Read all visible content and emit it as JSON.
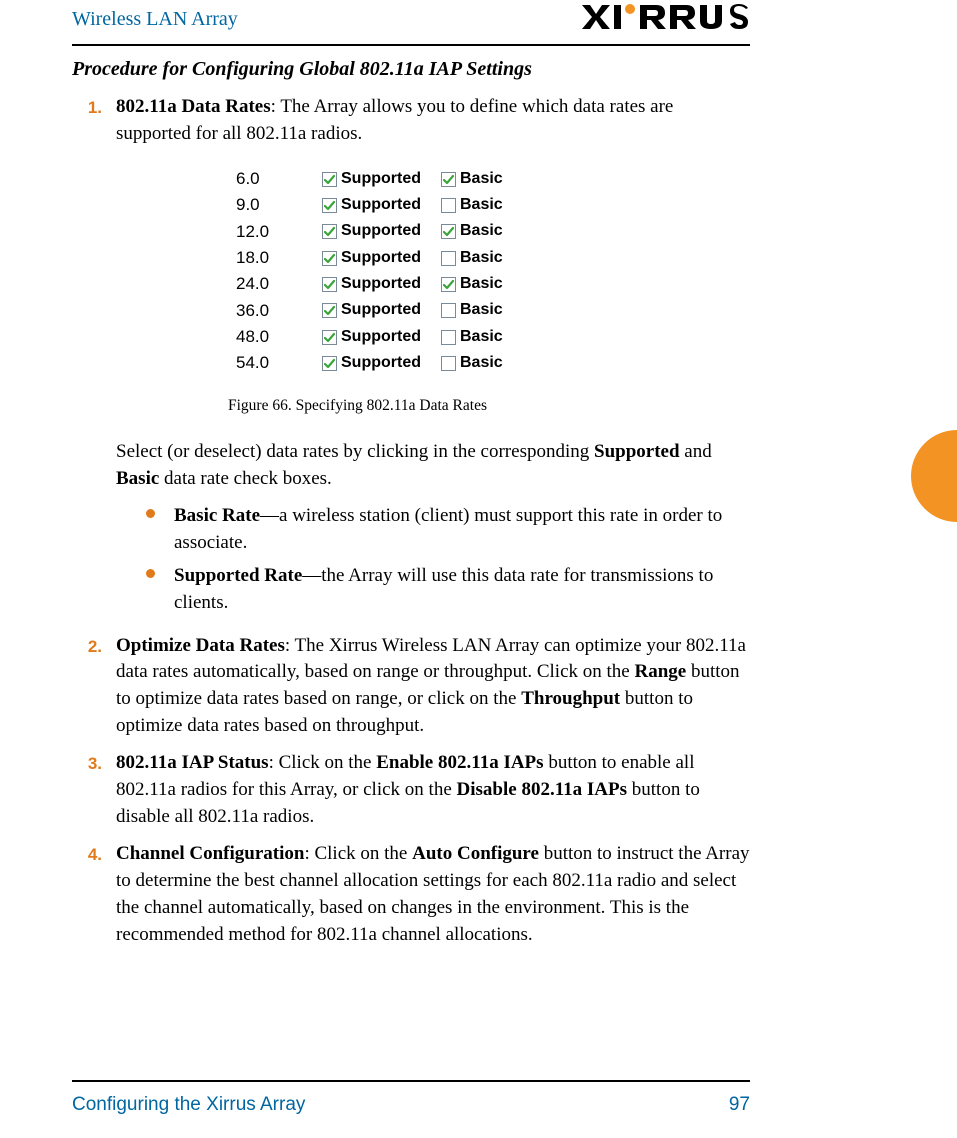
{
  "header": {
    "title": "Wireless LAN Array",
    "logo_text": "XIRRUS"
  },
  "section_heading": "Procedure for Configuring Global 802.11a IAP Settings",
  "steps": {
    "s1": {
      "num": "1.",
      "bold": "802.11a Data Rates",
      "rest": ": The Array allows you to define which data rates are supported for all 802.11a radios."
    },
    "s2": {
      "num": "2.",
      "bold": "Optimize Data Rates",
      "text_a": ": The Xirrus Wireless LAN Array can optimize your 802.11a data rates automatically, based on range or throughput. Click on the ",
      "bold_b": "Range",
      "text_b": " button to optimize data rates based on range, or click on the ",
      "bold_c": "Throughput",
      "text_c": " button to optimize data rates based on throughput."
    },
    "s3": {
      "num": "3.",
      "bold": "802.11a IAP Status",
      "text_a": ": Click on the ",
      "bold_b": "Enable 802.11a IAPs",
      "text_b": " button to enable all 802.11a radios for this Array, or click on the ",
      "bold_c": "Disable 802.11a IAPs",
      "text_c": " button to disable all 802.11a radios."
    },
    "s4": {
      "num": "4.",
      "bold": "Channel Configuration",
      "text_a": ": Click on the ",
      "bold_b": "Auto Configure",
      "text_b": " button to instruct the Array to determine the best channel allocation settings for each 802.11a radio and select the channel automatically, based on changes in the environment. This is the recommended method for 802.11a channel allocations."
    }
  },
  "after_figure": {
    "text_a": "Select (or deselect) data rates by clicking in the corresponding ",
    "bold_a": "Supported",
    "text_b": " and ",
    "bold_b": "Basic",
    "text_c": " data rate check boxes."
  },
  "sub": {
    "i1": {
      "bold": "Basic Rate",
      "rest": "—a wireless station (client) must support this rate in order to associate."
    },
    "i2": {
      "bold": "Supported Rate",
      "rest": "—the Array will use this data rate for transmissions to clients."
    }
  },
  "figure": {
    "caption": "Figure 66. Specifying 802.11a Data Rates",
    "labels": {
      "supported": "Supported",
      "basic": "Basic"
    },
    "rows": {
      "r0": {
        "rate": "6.0",
        "supported": true,
        "basic": true
      },
      "r1": {
        "rate": "9.0",
        "supported": true,
        "basic": false
      },
      "r2": {
        "rate": "12.0",
        "supported": true,
        "basic": true
      },
      "r3": {
        "rate": "18.0",
        "supported": true,
        "basic": false
      },
      "r4": {
        "rate": "24.0",
        "supported": true,
        "basic": true
      },
      "r5": {
        "rate": "36.0",
        "supported": true,
        "basic": false
      },
      "r6": {
        "rate": "48.0",
        "supported": true,
        "basic": false
      },
      "r7": {
        "rate": "54.0",
        "supported": true,
        "basic": false
      }
    }
  },
  "footer": {
    "left": "Configuring the Xirrus Array",
    "right": "97"
  },
  "colors": {
    "accent_blue": "#0066a1",
    "accent_orange": "#e07a1b",
    "tab_orange": "#f39323",
    "check_green": "#3aa53a"
  }
}
